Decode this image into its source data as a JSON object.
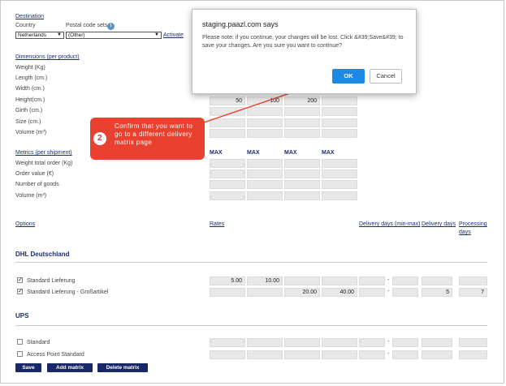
{
  "destination": {
    "heading": "Destination",
    "country_label": "Country",
    "postal_label": "Postal code sets",
    "country_value": "Netherlands",
    "postal_value": "(Other)",
    "activate_link": "Activate"
  },
  "dimensions": {
    "heading": "Dimensions (per product)",
    "rows": [
      "Weight (Kg)",
      "Length (cm.)",
      "Width (cm.)",
      "Height(cm.)",
      "Girth (cm.)",
      "Size (cm.)",
      "Volume (m³)"
    ],
    "height_values": [
      "50",
      "100",
      "200"
    ]
  },
  "metrics": {
    "heading": "Metrics (per shipment)",
    "max_labels": [
      "MAX",
      "MAX",
      "MAX",
      "MAX"
    ],
    "rows": [
      "Weight total order (Kg)",
      "Order value (€)",
      "Number of goods",
      "Volume (m³)"
    ]
  },
  "table_headers": {
    "options": "Options",
    "rates": "Rates",
    "delivery_min_max": "Delivery days (min-max)",
    "delivery_days": "Delivery days",
    "processing_days_1": "Processing",
    "processing_days_2": "days"
  },
  "carriers": [
    {
      "name": "DHL Deutschland",
      "rows": [
        {
          "label": "Standard Lieferung",
          "checked": true,
          "rates": [
            "5.00",
            "10.00",
            "",
            ""
          ],
          "dash": "-",
          "delivery": "",
          "processing": ""
        },
        {
          "label": "Standard Lieferung - Großartikel",
          "checked": true,
          "rates": [
            "",
            "",
            "20.00",
            "40.00"
          ],
          "dash": "-",
          "delivery": "5",
          "processing": "7"
        }
      ]
    },
    {
      "name": "UPS",
      "rows": [
        {
          "label": "Standard",
          "checked": false,
          "rates": [
            "",
            "",
            "",
            ""
          ],
          "dash": "-",
          "delivery": "",
          "processing": ""
        },
        {
          "label": "Access Point Standard",
          "checked": false,
          "rates": [
            "",
            "",
            "",
            ""
          ],
          "dash": "-",
          "delivery": "",
          "processing": ""
        }
      ]
    }
  ],
  "buttons": {
    "save": "Save",
    "add_matrix": "Add matrix",
    "delete_matrix": "Delete matrix"
  },
  "dialog": {
    "title": "staging.paazl.com says",
    "message": "Please note: if you continue, your changes will be lost. Click &#39;Save&#39; to save your changes. Are you sure you want to continue?",
    "ok": "OK",
    "cancel": "Cancel"
  },
  "callout": {
    "step": "2",
    "text": "Confirm that you want to go to a different delivery matrix page"
  },
  "colors": {
    "accent_navy": "#1a2766",
    "ok_blue": "#1e88e5",
    "callout_red": "#e8412f"
  }
}
